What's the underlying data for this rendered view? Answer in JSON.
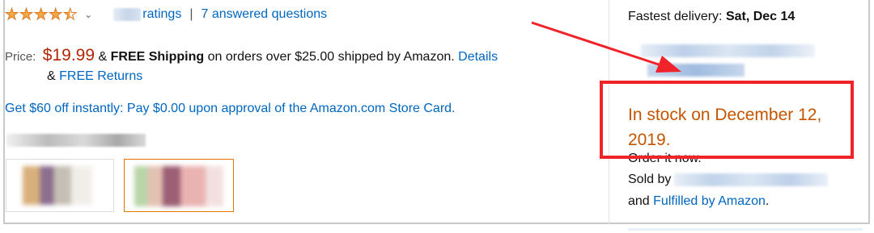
{
  "rating": {
    "stars_value": 4.5,
    "chevron": "chevron-down-icon",
    "ratings_label": "ratings",
    "separator": "|",
    "questions_link": "7 answered questions"
  },
  "price": {
    "label": "Price:",
    "amount": "$19.99",
    "amp": "&",
    "free_shipping": "FREE Shipping",
    "shipping_text": "on orders over $25.00 shipped by Amazon.",
    "details_link": "Details",
    "returns_amp": "&",
    "returns_link": "FREE Returns"
  },
  "promo": {
    "text": "Get $60 off instantly: Pay $0.00 upon approval of the Amazon.com Store Card."
  },
  "delivery": {
    "fastest_label": "Fastest delivery:",
    "fastest_date": "Sat, Dec 14"
  },
  "availability": {
    "stock_text": "In stock on December 12, 2019.",
    "order_text": "Order it now.",
    "sold_by_label": "Sold by",
    "fulfilled_prefix": "and",
    "fulfilled_link": "Fulfilled by Amazon",
    "fulfilled_suffix": "."
  },
  "colors": {
    "link": "#0066c0",
    "price": "#b12704",
    "stock": "#c45500",
    "annotation": "#f0232b"
  }
}
